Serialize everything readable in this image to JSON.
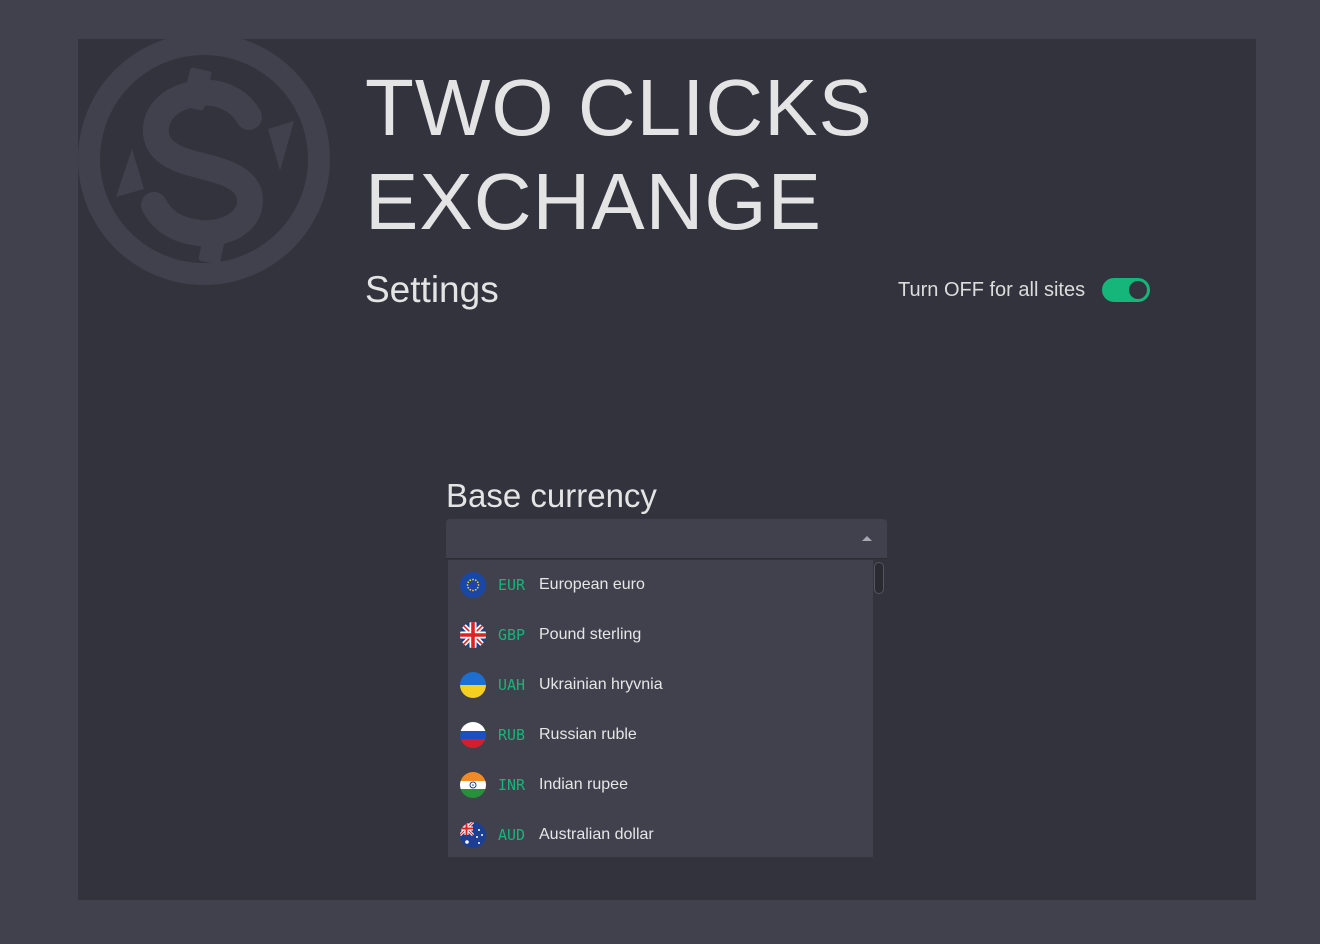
{
  "app": {
    "title_line1": "TWO CLICKS",
    "title_line2": "EXCHANGE",
    "logo_icon": "dollar-exchange-icon"
  },
  "settings": {
    "heading": "Settings",
    "toggle_label": "Turn OFF for all sites",
    "toggle_on": true,
    "accent_color": "#16b579"
  },
  "base_currency": {
    "label": "Base currency",
    "selected_value": "",
    "dropdown_open": true,
    "options": [
      {
        "code": "EUR",
        "name": "European euro",
        "flag_icon": "eu-flag-icon"
      },
      {
        "code": "GBP",
        "name": "Pound sterling",
        "flag_icon": "uk-flag-icon"
      },
      {
        "code": "UAH",
        "name": "Ukrainian hryvnia",
        "flag_icon": "ukraine-flag-icon"
      },
      {
        "code": "RUB",
        "name": "Russian ruble",
        "flag_icon": "russia-flag-icon"
      },
      {
        "code": "INR",
        "name": "Indian rupee",
        "flag_icon": "india-flag-icon"
      },
      {
        "code": "AUD",
        "name": "Australian dollar",
        "flag_icon": "australia-flag-icon"
      }
    ]
  }
}
